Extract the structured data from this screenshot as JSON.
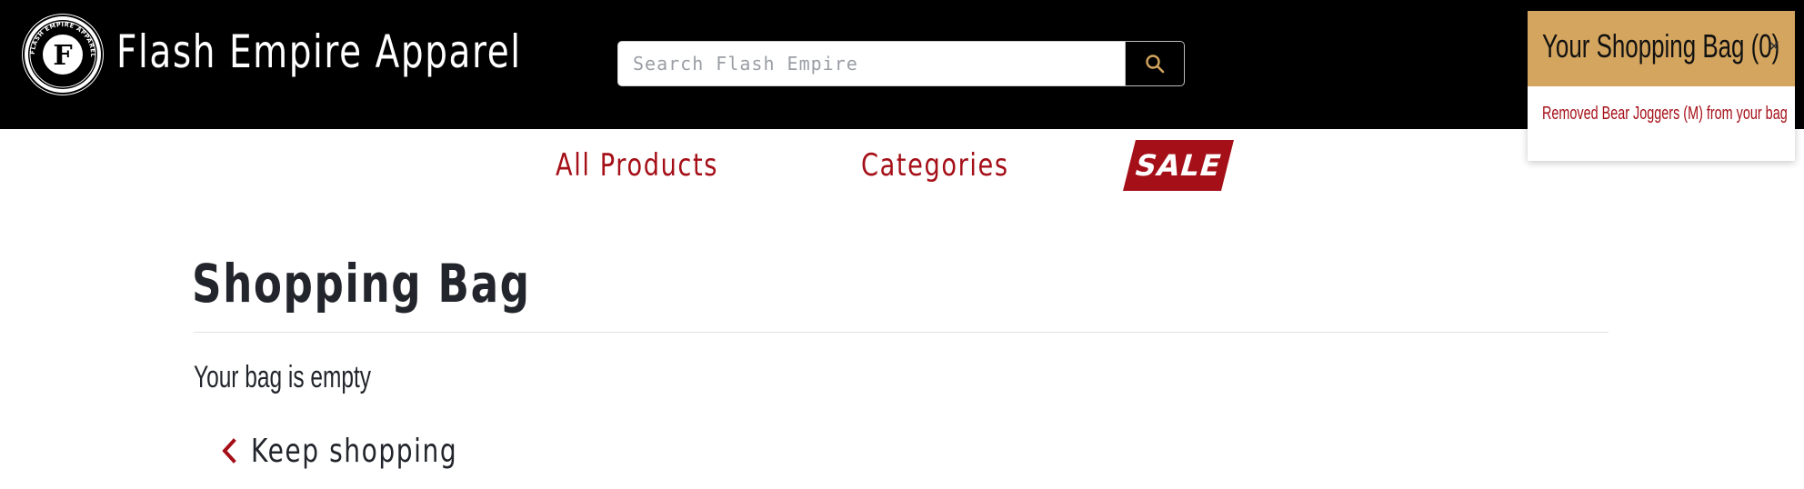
{
  "header": {
    "brand_name": "Flash Empire Apparel",
    "logo": {
      "initial": "F",
      "ring_text": "FLASH EMPIRE APPAREL"
    }
  },
  "search": {
    "placeholder": "Search Flash Empire",
    "button_icon": "search-icon"
  },
  "nav": {
    "items": [
      {
        "label": "All Products"
      },
      {
        "label": "Categories"
      }
    ],
    "sale_label": "SALE"
  },
  "main": {
    "title": "Shopping Bag",
    "empty_message": "Your bag is empty",
    "keep_shopping_label": "Keep shopping",
    "keep_shopping_icon": "chevron-left-icon"
  },
  "bag_popup": {
    "title": "Your Shopping Bag (0)",
    "close_label": "×",
    "message": "Removed Bear Joggers (M) from your bag"
  },
  "colors": {
    "header_bg": "#000000",
    "accent_red": "#a50f18",
    "popup_header": "#d4a55f",
    "search_icon": "#d4a55f",
    "text_dark": "#22252b"
  }
}
